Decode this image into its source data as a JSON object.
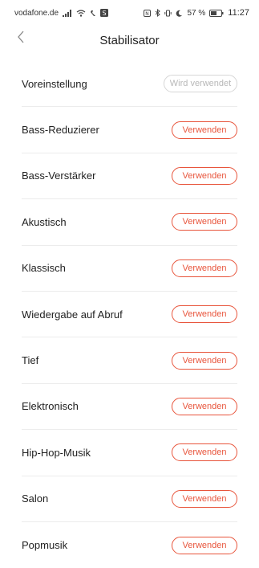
{
  "status_bar": {
    "carrier": "vodafone.de",
    "battery_percent": "57 %",
    "time": "11:27"
  },
  "header": {
    "title": "Stabilisator"
  },
  "colors": {
    "accent": "#e8553c",
    "disabled_border": "#d6d6d6",
    "disabled_text": "#b8b8b8"
  },
  "presets": [
    {
      "label": "Voreinstellung",
      "button": "Wird verwendet",
      "active": false
    },
    {
      "label": "Bass-Reduzierer",
      "button": "Verwenden",
      "active": true
    },
    {
      "label": "Bass-Verstärker",
      "button": "Verwenden",
      "active": true
    },
    {
      "label": "Akustisch",
      "button": "Verwenden",
      "active": true
    },
    {
      "label": "Klassisch",
      "button": "Verwenden",
      "active": true
    },
    {
      "label": "Wiedergabe auf Abruf",
      "button": "Verwenden",
      "active": true
    },
    {
      "label": "Tief",
      "button": "Verwenden",
      "active": true
    },
    {
      "label": "Elektronisch",
      "button": "Verwenden",
      "active": true
    },
    {
      "label": "Hip-Hop-Musik",
      "button": "Verwenden",
      "active": true
    },
    {
      "label": "Salon",
      "button": "Verwenden",
      "active": true
    },
    {
      "label": "Popmusik",
      "button": "Verwenden",
      "active": true
    }
  ]
}
